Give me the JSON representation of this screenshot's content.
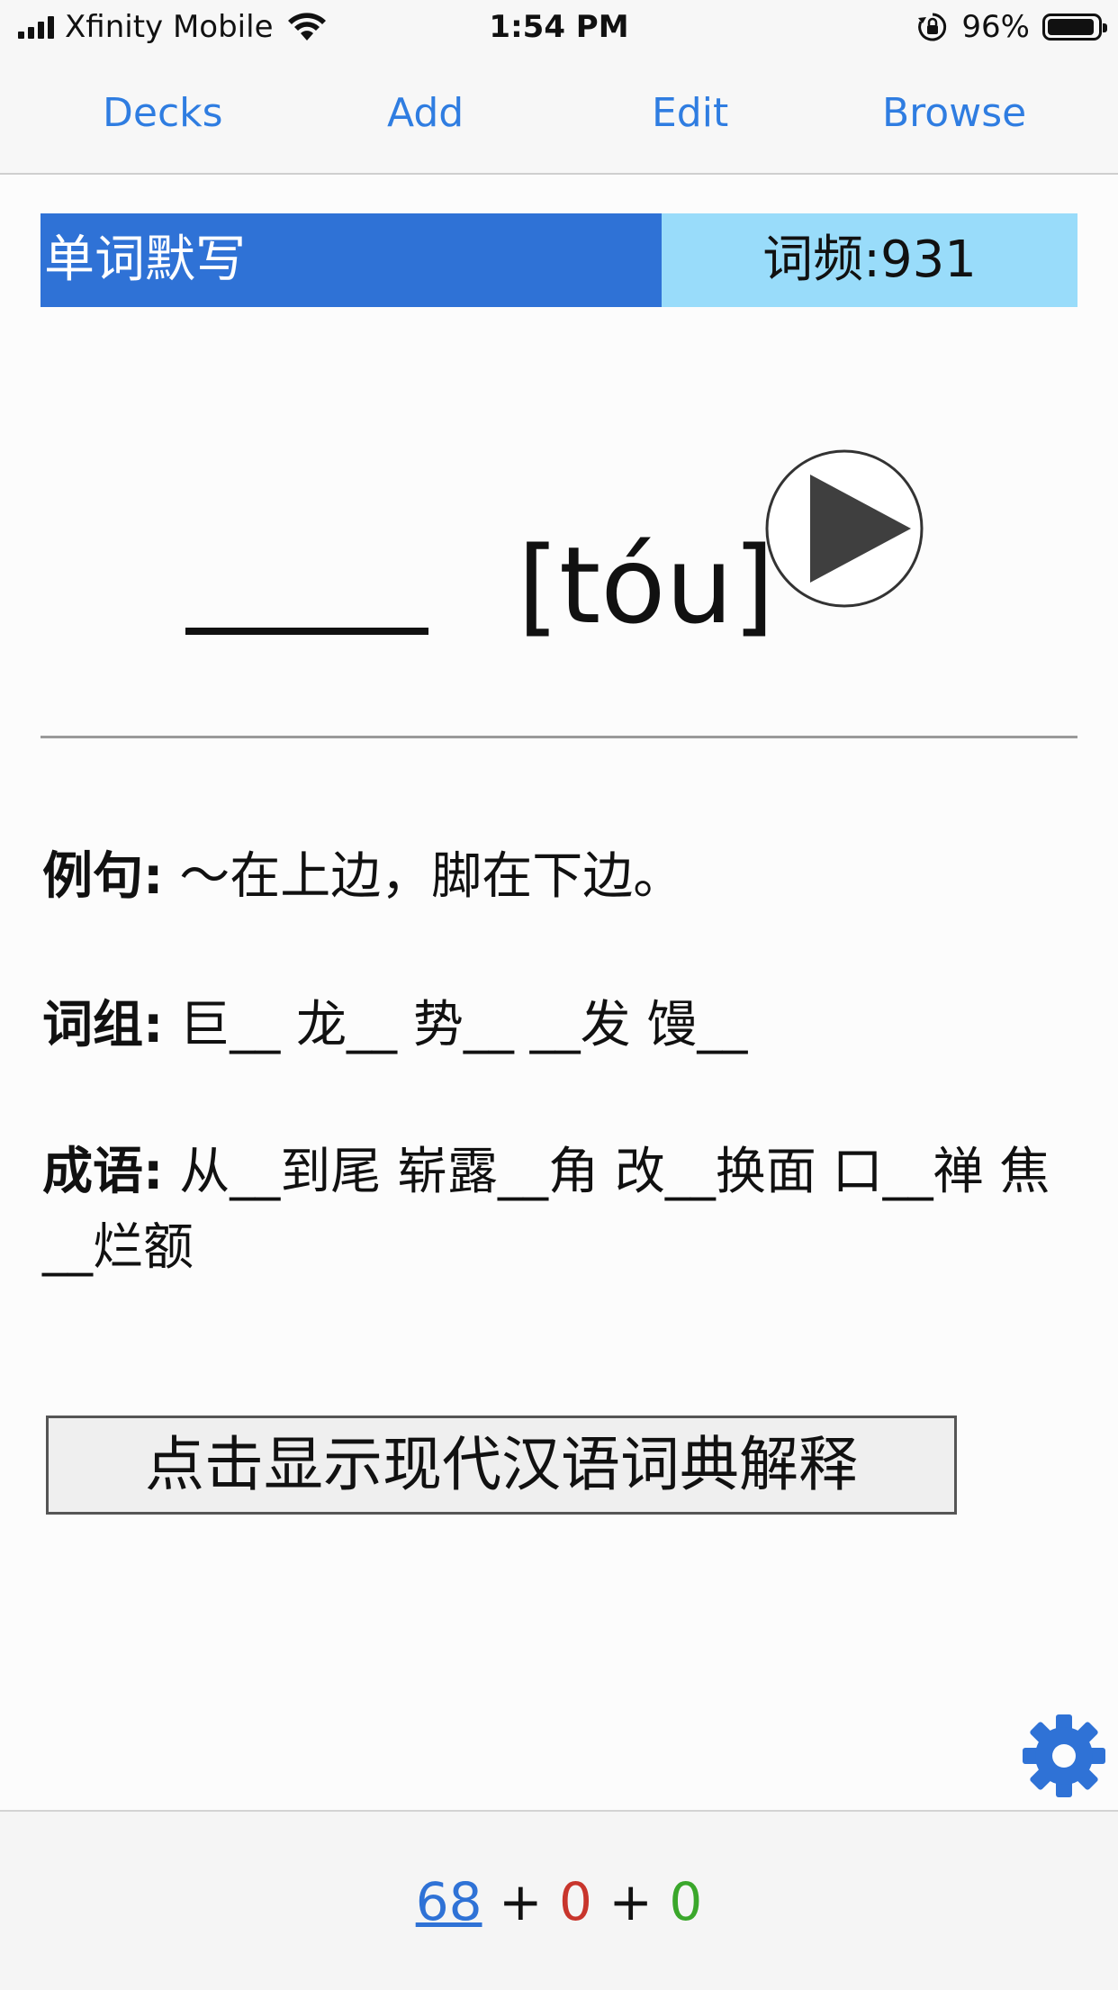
{
  "status_bar": {
    "carrier": "Xfinity Mobile",
    "time": "1:54 PM",
    "battery": "96%"
  },
  "nav": {
    "decks": "Decks",
    "add": "Add",
    "edit": "Edit",
    "browse": "Browse"
  },
  "card": {
    "header_title": "单词默写",
    "frequency": "词频:931",
    "pinyin": "[tóu]",
    "example_label": "例句:",
    "example_text": "～在上边，脚在下边。",
    "phrase_label": "词组:",
    "phrase_text": "巨__ 龙__ 势__ __发 馒__",
    "idiom_label": "成语:",
    "idiom_text": "从__到尾 崭露__角 改__换面 口__禅 焦__烂额",
    "dict_button": "点击显示现代汉语词典解释"
  },
  "counts": {
    "new": "68",
    "plus1": "+",
    "learn": "0",
    "plus2": "+",
    "review": "0"
  },
  "colors": {
    "accent": "#2f7de1",
    "header_dark": "#2f72d6",
    "header_light": "#99dcfa",
    "learn": "#c8352c",
    "review": "#3aa72b"
  },
  "icons": [
    "signal-icon",
    "wifi-icon",
    "rotation-lock-icon",
    "battery-icon",
    "play-icon",
    "gear-icon"
  ]
}
